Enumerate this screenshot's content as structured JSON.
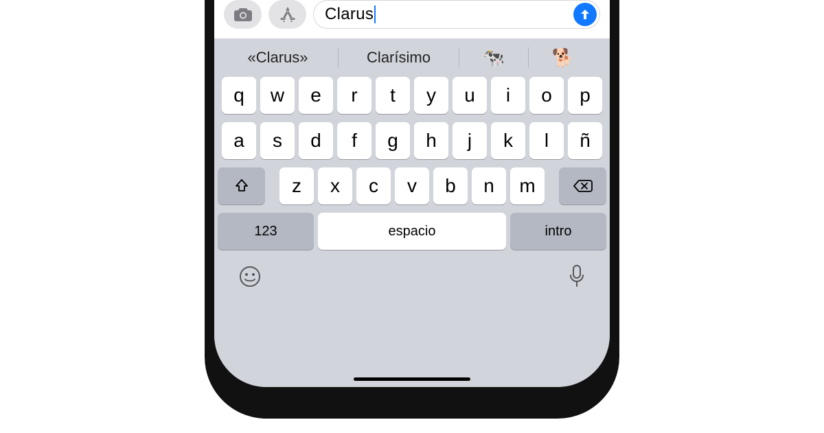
{
  "compose": {
    "text": "Clarus"
  },
  "suggestions": {
    "s1": "«Clarus»",
    "s2": "Clarísimo",
    "s3": "🐄",
    "s4": "🐕"
  },
  "keys": {
    "row1": [
      "q",
      "w",
      "e",
      "r",
      "t",
      "y",
      "u",
      "i",
      "o",
      "p"
    ],
    "row2": [
      "a",
      "s",
      "d",
      "f",
      "g",
      "h",
      "j",
      "k",
      "l",
      "ñ"
    ],
    "row3": [
      "z",
      "x",
      "c",
      "v",
      "b",
      "n",
      "m"
    ],
    "numLabel": "123",
    "spaceLabel": "espacio",
    "enterLabel": "intro"
  }
}
